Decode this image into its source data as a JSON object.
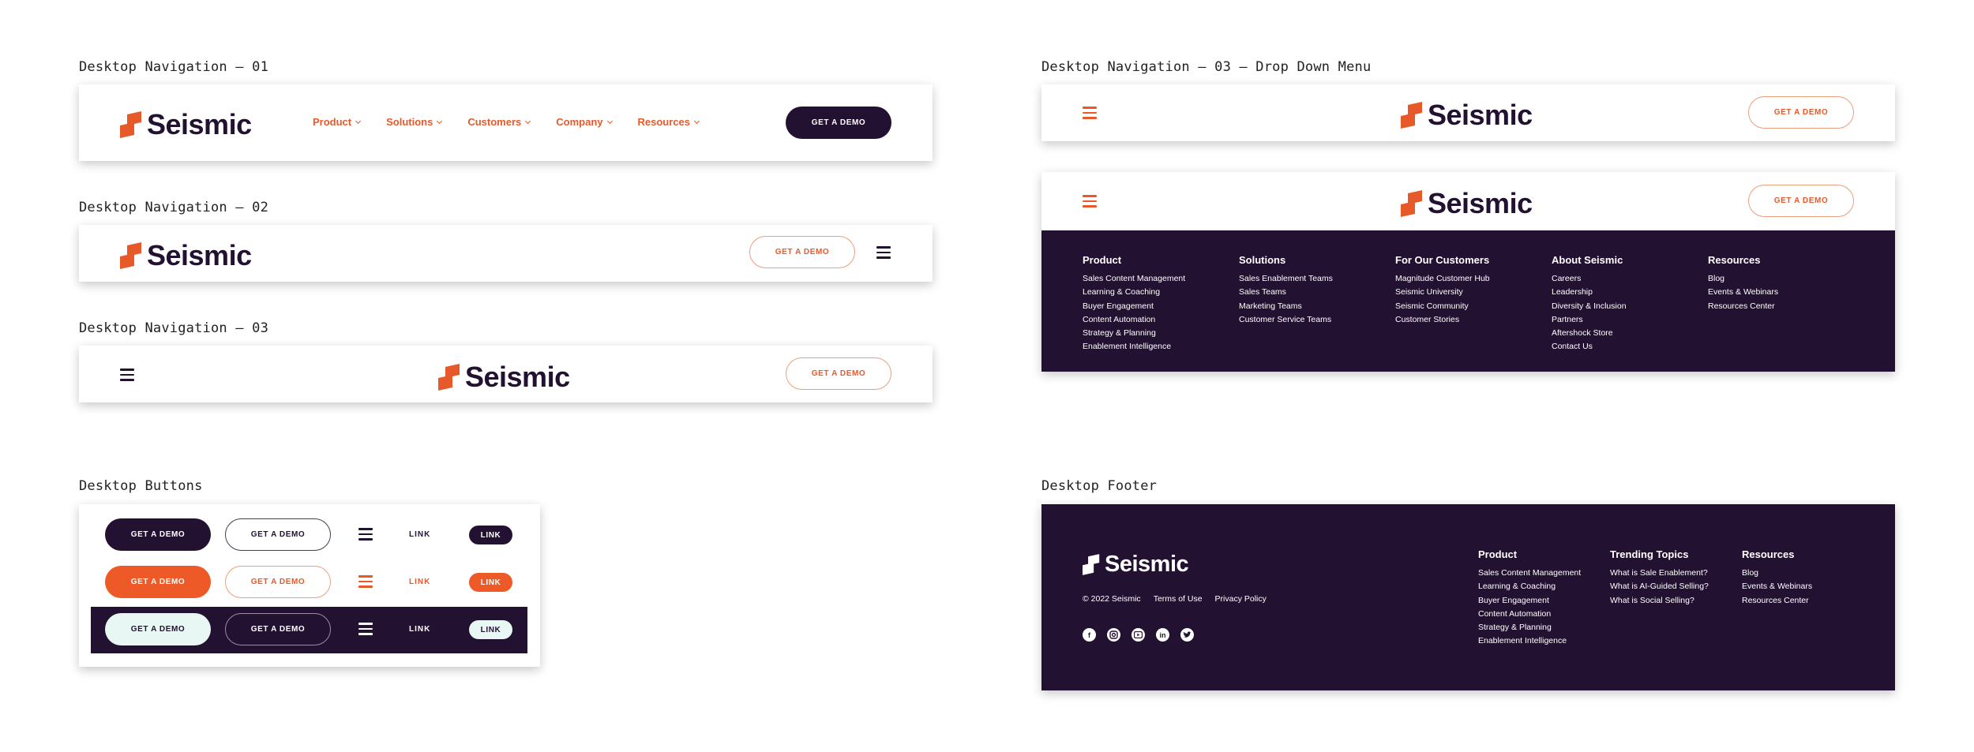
{
  "labels": {
    "nav01": "Desktop Navigation – 01",
    "nav02": "Desktop Navigation – 02",
    "nav03": "Desktop Navigation – 03",
    "nav03dd": "Desktop Navigation – 03 – Drop Down Menu",
    "buttons": "Desktop Buttons",
    "footer": "Desktop Footer"
  },
  "brand": {
    "name": "Seismic",
    "colors": {
      "dark": "#231131",
      "orange": "#e8592a",
      "light": "#e8f6f4"
    }
  },
  "nav": {
    "links": [
      "Product",
      "Solutions",
      "Customers",
      "Company",
      "Resources"
    ],
    "cta": "GET A DEMO"
  },
  "buttons": {
    "cta": "GET A DEMO",
    "link": "LINK"
  },
  "dropdown": {
    "columns": [
      {
        "title": "Product",
        "items": [
          "Sales Content Management",
          "Learning & Coaching",
          "Buyer Engagement",
          "Content Automation",
          "Strategy & Planning",
          "Enablement Intelligence"
        ]
      },
      {
        "title": "Solutions",
        "items": [
          "Sales Enablement Teams",
          "Sales Teams",
          "Marketing Teams",
          "Customer Service Teams"
        ]
      },
      {
        "title": "For Our Customers",
        "items": [
          "Magnitude Customer Hub",
          "Seismic University",
          "Seismic Community",
          "Customer Stories"
        ]
      },
      {
        "title": "About Seismic",
        "items": [
          "Careers",
          "Leadership",
          "Diversity & Inclusion",
          "Partners",
          "Aftershock Store",
          "Contact Us"
        ]
      },
      {
        "title": "Resources",
        "items": [
          "Blog",
          "Events & Webinars",
          "Resources Center"
        ]
      }
    ]
  },
  "footer": {
    "copyright": "© 2022 Seismic",
    "terms": "Terms of Use",
    "privacy": "Privacy Policy",
    "socials": [
      "facebook-icon",
      "instagram-icon",
      "youtube-icon",
      "linkedin-icon",
      "twitter-icon"
    ],
    "columns": [
      {
        "title": "Product",
        "items": [
          "Sales Content Management",
          "Learning & Coaching",
          "Buyer Engagement",
          "Content Automation",
          "Strategy & Planning",
          "Enablement Intelligence"
        ]
      },
      {
        "title": "Trending Topics",
        "items": [
          "What is Sale Enablement?",
          "What is AI-Guided Selling?",
          "What is Social Selling?"
        ]
      },
      {
        "title": "Resources",
        "items": [
          "Blog",
          "Events & Webinars",
          "Resources Center"
        ]
      }
    ]
  }
}
